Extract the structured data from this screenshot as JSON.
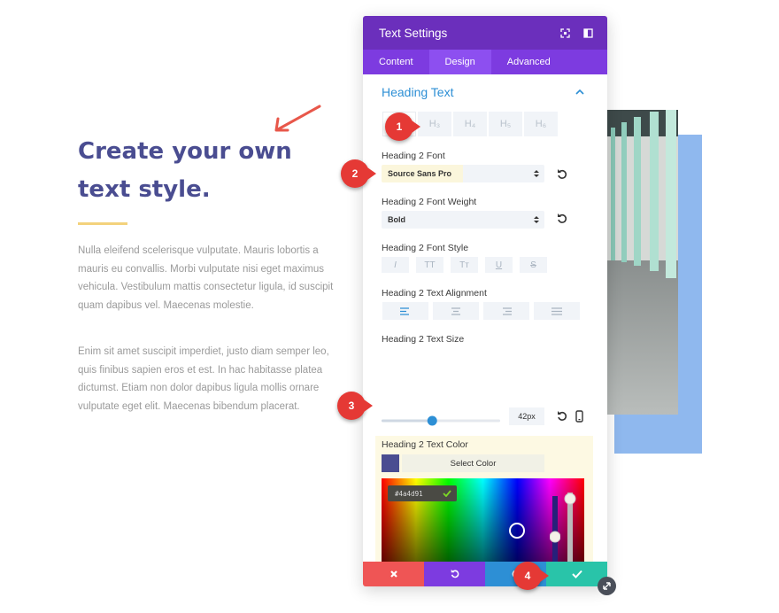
{
  "page": {
    "heading_line1": "Create your own",
    "heading_line2": "text style.",
    "paragraph1": "Nulla eleifend scelerisque vulputate. Mauris lobortis a mauris eu convallis. Morbi vulputate nisi eget maximus vehicula. Vestibulum mattis consectetur ligula, id suscipit quam dapibus vel. Maecenas molestie.",
    "paragraph2": "Enim sit amet suscipit imperdiet, justo diam semper leo, quis finibus sapien eros et est. In hac habitasse platea dictumst. Etiam non dolor dapibus ligula mollis ornare vulputate eget elit. Maecenas bibendum placerat."
  },
  "panel": {
    "title": "Text Settings",
    "tabs": [
      "Content",
      "Design",
      "Advanced"
    ],
    "active_tab": "Design",
    "section_title": "Heading Text",
    "heading_levels": [
      "H₂",
      "H₃",
      "H₄",
      "H₅",
      "H₆"
    ],
    "active_heading": "H₂",
    "font_label": "Heading 2 Font",
    "font_value": "Source Sans Pro",
    "weight_label": "Heading 2 Font Weight",
    "weight_value": "Bold",
    "style_label": "Heading 2 Font Style",
    "style_buttons": [
      "I",
      "TT",
      "Tт",
      "U",
      "S"
    ],
    "align_label": "Heading 2 Text Alignment",
    "size_label": "Heading 2 Text Size",
    "size_value": "42px",
    "slider_fraction": 0.42,
    "color_label": "Heading 2 Text Color",
    "select_color_label": "Select Color",
    "hex_value": "#4a4d91",
    "selected_color": "#4a4d91",
    "preset_colors": [
      "#000000",
      "#ffffff",
      "#e02b20",
      "#e09900",
      "#edf000",
      "#7cda24",
      "#0c71c3",
      "#8300e9"
    ]
  },
  "footer": {
    "colors": [
      "#ef5555",
      "#7d3be0",
      "#2d8fd5",
      "#29c4a9"
    ]
  },
  "badges": [
    "1",
    "2",
    "3",
    "4"
  ],
  "colors": {
    "accent_purple": "#6b2fbc",
    "tab_purple": "#7d3be0",
    "link_blue": "#2d8fd5",
    "heading": "#4a4d91",
    "badge_red": "#e53935"
  }
}
